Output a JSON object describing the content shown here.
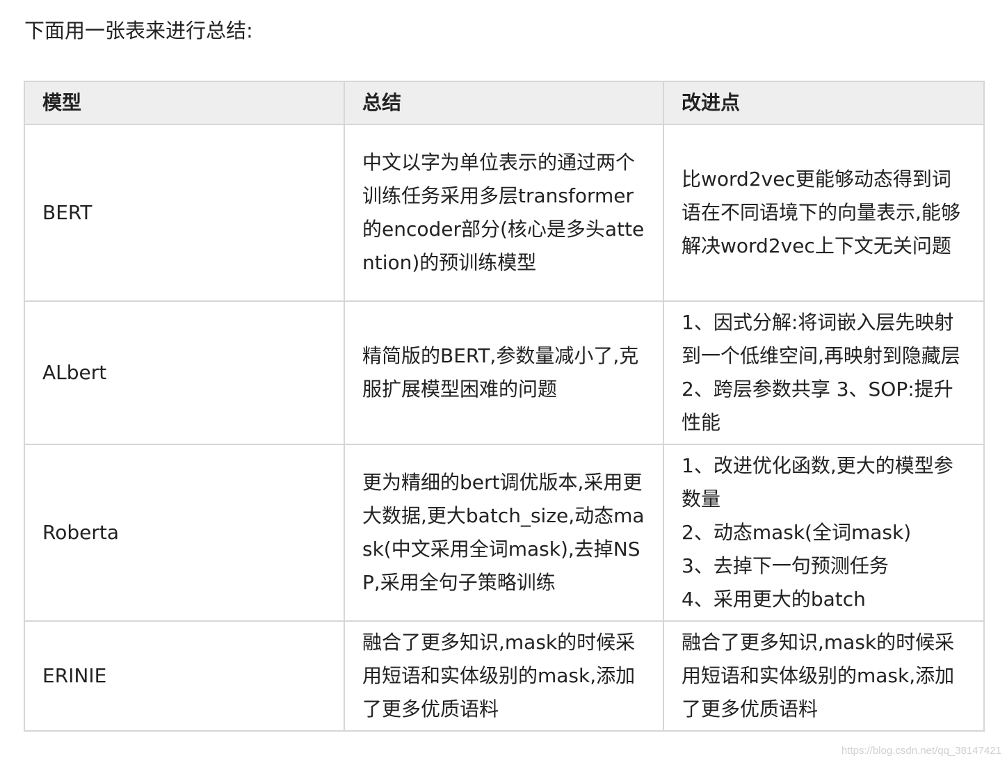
{
  "intro_text": "下面用一张表来进行总结:",
  "table": {
    "headers": [
      "模型",
      "总结",
      "改进点"
    ],
    "rows": [
      {
        "model": "BERT",
        "summary": "中文以字为单位表示的通过两个训练任务采用多层transformer的encoder部分(核心是多头attention)的预训练模型",
        "improvements": [
          "比word2vec更能够动态得到词语在不同语境下的向量表示,能够解决word2vec上下文无关问题"
        ]
      },
      {
        "model": "ALbert",
        "summary": "精简版的BERT,参数量减小了,克服扩展模型困难的问题",
        "improvements": [
          "1、因式分解:将词嵌入层先映射到一个低维空间,再映射到隐藏层 2、跨层参数共享 3、SOP:提升性能"
        ]
      },
      {
        "model": "Roberta",
        "summary": "更为精细的bert调优版本,采用更大数据,更大batch_size,动态mask(中文采用全词mask),去掉NSP,采用全句子策略训练",
        "improvements": [
          "1、改进优化函数,更大的模型参数量",
          "2、动态mask(全词mask)",
          "3、去掉下一句预测任务",
          "4、采用更大的batch"
        ]
      },
      {
        "model": "ERINIE",
        "summary": "融合了更多知识,mask的时候采用短语和实体级别的mask,添加了更多优质语料",
        "improvements": [
          "融合了更多知识,mask的时候采用短语和实体级别的mask,添加了更多优质语料"
        ]
      }
    ]
  },
  "watermark": "https://blog.csdn.net/qq_38147421"
}
